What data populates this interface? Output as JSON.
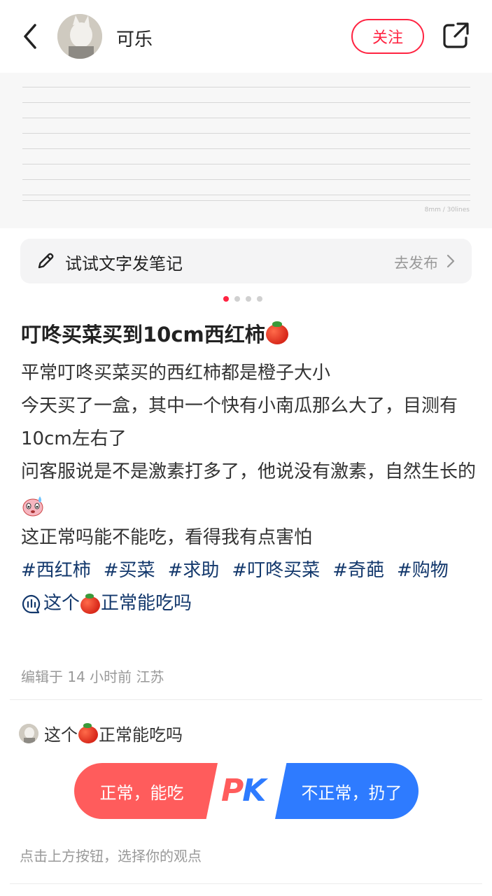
{
  "header": {
    "username": "可乐",
    "follow_label": "关注",
    "icons": [
      "back-icon",
      "avatar",
      "share-icon"
    ]
  },
  "image": {
    "paper_note": "8mm / 30lines",
    "carousel": {
      "total": 4,
      "active": 1
    }
  },
  "compose": {
    "label": "试试文字发笔记",
    "action": "去发布",
    "icon": "pencil-icon"
  },
  "post": {
    "title": "叮咚买菜买到10cm西红柿",
    "lines": [
      "平常叮咚买菜买的西红柿都是橙子大小",
      "今天买了一盒，其中一个快有小南瓜那么大了，目测有10cm左右了",
      "问客服说是不是激素打多了，他说没有激素，自然生长的",
      "这正常吗能不能吃，看得我有点害怕"
    ],
    "tags": [
      "#西红柿",
      "#买菜",
      "#求助",
      "#叮咚买菜",
      "#奇葩",
      "#购物"
    ],
    "poll_link_prefix": "这个",
    "poll_link_suffix": "正常能吃吗",
    "meta": "编辑于 14 小时前 江苏"
  },
  "poll": {
    "question_prefix": "这个",
    "question_suffix": "正常能吃吗",
    "option_left": "正常，能吃",
    "option_right": "不正常，扔了",
    "pk_p": "P",
    "pk_k": "K",
    "hint": "点击上方按钮，选择你的观点",
    "colors": {
      "left": "#ff5c5c",
      "right": "#2e7bff",
      "follow": "#ff2442",
      "tag": "#13386c"
    }
  }
}
